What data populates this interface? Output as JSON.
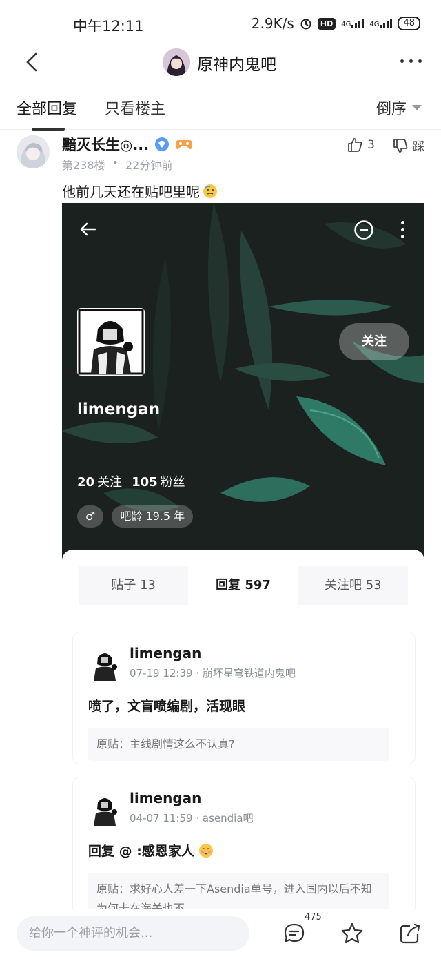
{
  "status_bar": {
    "time": "中午12:11",
    "speed": "2.9K/s",
    "hd": "HD",
    "net1": "4G",
    "net2": "4G",
    "battery": "48"
  },
  "header": {
    "title": "原神内鬼吧"
  },
  "tabs": {
    "all": "全部回复",
    "op_only": "只看楼主",
    "sort": "倒序"
  },
  "post": {
    "username": "黯灭长生◎...",
    "floor": "第238楼",
    "time_ago": "22分钟前",
    "likes": "3",
    "dislike_label": "踩",
    "text": "他前几天还在贴吧里呢"
  },
  "embedded_profile": {
    "name": "limengan",
    "follow_button": "关注",
    "following_count": "20",
    "following_label": "关注",
    "fans_count": "105",
    "fans_label": "粉丝",
    "gender": "♂",
    "bar_age": "吧龄 19.5 年",
    "tabs": {
      "posts": "贴子 13",
      "replies": "回复 597",
      "followed_bars": "关注吧 53"
    },
    "replies": [
      {
        "name": "limengan",
        "meta": "07-19 12:39 · 崩坏星穹铁道内鬼吧",
        "text": "喷了，文盲喷编剧，活现眼",
        "quote": "原贴：主线剧情这么不认真?"
      },
      {
        "name": "limengan",
        "meta": "04-07 11:59 · asendia吧",
        "text": "回复 @ :感恩家人",
        "quote": "原贴：求好心人差一下Asendia单号，进入国内以后不知为何卡在海关也不"
      }
    ]
  },
  "bottom_bar": {
    "input_placeholder": "给你一个神评的机会...",
    "comment_count": "475"
  },
  "colors": {
    "hero_dark_green": "#1e2422",
    "leaf_green": "#2f7a66",
    "chip_bg": "rgba(255,255,255,0.22)"
  }
}
